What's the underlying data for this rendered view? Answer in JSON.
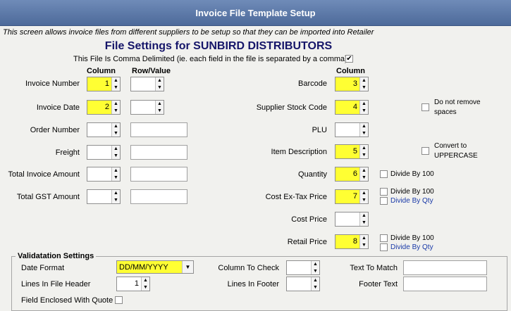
{
  "window": {
    "title": "Invoice File Template Setup",
    "intro": "This screen allows invoice files from different suppliers to be setup so that they can be imported into Retailer"
  },
  "settings": {
    "heading": "File Settings for SUNBIRD DISTRIBUTORS",
    "comma_label": "This File Is Comma Delimited (ie. each field in the file is separated by a comma)",
    "comma_checked": "✔"
  },
  "left": {
    "col_header": "Column",
    "row_header": "Row/Value",
    "fields": [
      {
        "label": "Invoice Number",
        "column": "1"
      },
      {
        "label": "Invoice Date",
        "column": "2"
      },
      {
        "label": "Order Number",
        "column": ""
      },
      {
        "label": "Freight",
        "column": ""
      },
      {
        "label": "Total Invoice Amount",
        "column": ""
      },
      {
        "label": "Total GST Amount",
        "column": ""
      }
    ]
  },
  "right": {
    "col_header": "Column",
    "fields": [
      {
        "label": "Barcode",
        "column": "3"
      },
      {
        "label": "Supplier Stock Code",
        "column": "4"
      },
      {
        "label": "PLU",
        "column": ""
      },
      {
        "label": "Item Description",
        "column": "5"
      },
      {
        "label": "Quantity",
        "column": "6"
      },
      {
        "label": "Cost Ex-Tax Price",
        "column": "7"
      },
      {
        "label": "Cost Price",
        "column": ""
      },
      {
        "label": "Retail Price",
        "column": "8"
      }
    ],
    "options": {
      "do_not_remove_spaces_1": "Do not remove",
      "do_not_remove_spaces_2": "spaces",
      "convert_upper_1": "Convert to",
      "convert_upper_2": "UPPERCASE",
      "divide_100": "Divide By 100",
      "divide_qty": "Divide By Qty"
    }
  },
  "validation": {
    "title": "Validatation Settings",
    "date_format_label": "Date Format",
    "date_format_value": "DD/MM/YYYY",
    "lines_header_label": "Lines In File Header",
    "lines_header_value": "1",
    "enclosed_quote_label": "Field Enclosed With Quote",
    "column_check_label": "Column To Check",
    "lines_footer_label": "Lines In Footer",
    "text_match_label": "Text To Match",
    "footer_text_label": "Footer Text"
  },
  "icons": {
    "up": "▲",
    "down": "▼"
  }
}
